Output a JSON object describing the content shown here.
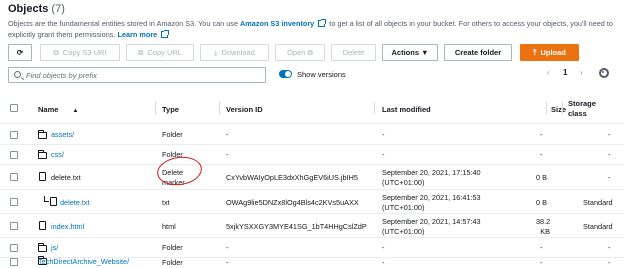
{
  "header": {
    "title": "Objects",
    "count": "(7)",
    "desc_part1": "Objects are the fundamental entities stored in Amazon S3. You can use ",
    "inventory_link": "Amazon S3 inventory",
    "desc_part2": " to get a list of all objects in your bucket. For others to access your objects, you'll need to explicitly grant them",
    "desc_part3": "permissions. ",
    "learn_more": "Learn more"
  },
  "toolbar": {
    "refresh_icon": "refresh-icon",
    "copy_uri": "Copy S3 URI",
    "copy_url": "Copy URL",
    "download": "Download",
    "open": "Open",
    "delete": "Delete",
    "actions": "Actions ▼",
    "create_folder": "Create folder",
    "upload": "Upload"
  },
  "search": {
    "placeholder": "Find objects by prefix"
  },
  "versions_toggle": {
    "label": "Show versions",
    "on": true
  },
  "pagination": {
    "page": "1",
    "prev": "‹",
    "next": "›"
  },
  "columns": {
    "name": "Name",
    "name_sort": "▲",
    "type": "Type",
    "version_id": "Version ID",
    "last_modified": "Last modified",
    "size": "Size",
    "storage_class_1": "Storage",
    "storage_class_2": "class"
  },
  "rows": [
    {
      "name": "assets/",
      "type": "Folder",
      "version_id": "-",
      "modified_1": "-",
      "modified_2": "",
      "size": "-",
      "storage": "-",
      "icon": "folder-icon"
    },
    {
      "name": "css/",
      "type": "Folder",
      "version_id": "-",
      "modified_1": "-",
      "modified_2": "",
      "size": "-",
      "storage": "-",
      "icon": "folder-icon"
    },
    {
      "name": "delete.txt",
      "type_1": "Delete",
      "type_2": "marker",
      "version_id": "CxYvbWAIyOpLE3dxXhGgEV6iUS.jbIH5",
      "modified_1": "September 20, 2021, 17:15:40",
      "modified_2": "(UTC+01:00)",
      "size": "0 B",
      "storage": "-",
      "icon": "file-icon"
    },
    {
      "name": "delete.txt",
      "type": "txt",
      "version_id": "OWAg9lie5DNZx8lOg4Bls4c2KVs5uAXX",
      "modified_1": "September 20, 2021, 16:41:53",
      "modified_2": "(UTC+01:00)",
      "size": "0 B",
      "storage": "Standard",
      "icon": "version-tree-icon"
    },
    {
      "name": "index.html",
      "type": "html",
      "version_id": "5xjkYSXXGY3MYE41SG_1bT4HHgCslZdP",
      "modified_1": "September 20, 2021, 14:57:43",
      "modified_2": "(UTC+01:00)",
      "size_1": "38.2",
      "size_2": "KB",
      "storage": "Standard",
      "icon": "file-icon"
    },
    {
      "name": "js/",
      "type": "Folder",
      "version_id": "-",
      "modified_1": "-",
      "modified_2": "",
      "size": "-",
      "storage": "-",
      "icon": "folder-icon"
    },
    {
      "name": "TechDirectArchive_Website/",
      "type": "Folder",
      "version_id": "-",
      "modified_1": "-",
      "modified_2": "",
      "size": "-",
      "storage": "-",
      "icon": "folder-icon"
    }
  ],
  "colors": {
    "accent": "#0073bb",
    "primary": "#ec7211",
    "annotation": "#d11a1a"
  }
}
